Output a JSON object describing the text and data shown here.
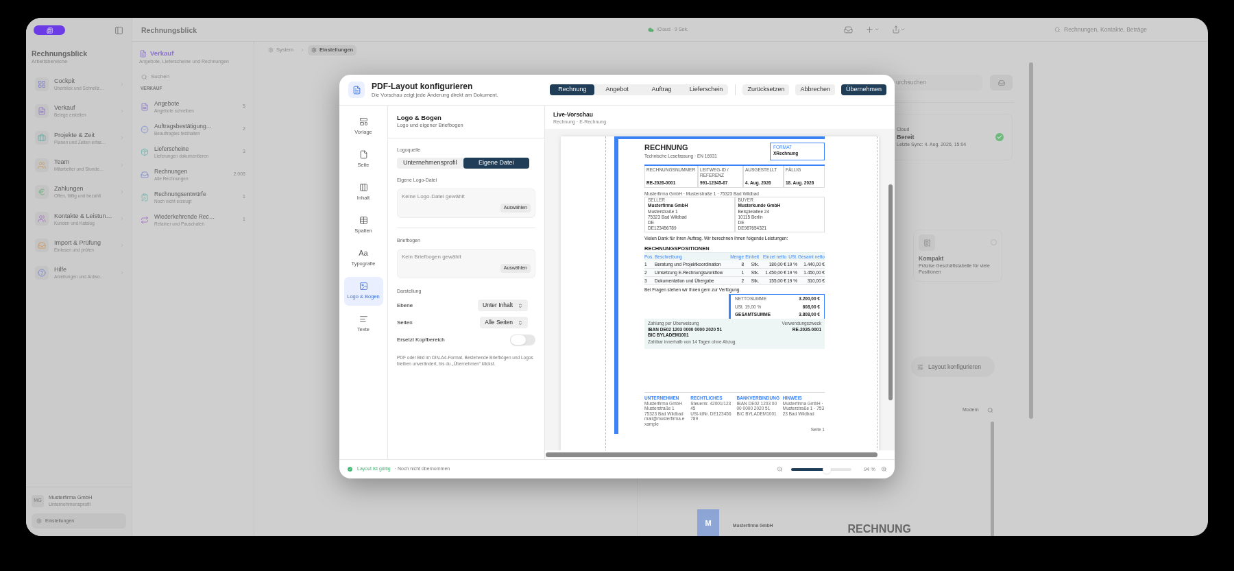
{
  "app": {
    "title": "Rechnungsblick",
    "sync": "iCloud · 9 Sek.",
    "search_placeholder": "Rechnungen, Kontakte, Beträge"
  },
  "breadcrumb": [
    {
      "label": "System",
      "selected": false
    },
    {
      "label": "Einstellungen",
      "selected": true
    }
  ],
  "sidebar": {
    "title": "Rechnungsblick",
    "subtitle": "Arbeitsbereiche",
    "items": [
      {
        "title": "Cockpit",
        "subtitle": "Überblick und Schnellz…"
      },
      {
        "title": "Verkauf",
        "subtitle": "Belege erstellen"
      },
      {
        "title": "Projekte & Zeit",
        "subtitle": "Planen und Zeiten erfas…"
      },
      {
        "title": "Team",
        "subtitle": "Mitarbeiter und Stunde…"
      },
      {
        "title": "Zahlungen",
        "subtitle": "Offen, fällig und bezahlt"
      },
      {
        "title": "Kontakte & Leistun…",
        "subtitle": "Kunden und Katalog"
      },
      {
        "title": "Import & Prüfung",
        "subtitle": "Einlesen und prüfen"
      },
      {
        "title": "Hilfe",
        "subtitle": "Anleitungen und Antwo…"
      }
    ],
    "account": {
      "initials": "MG",
      "name": "Musterfirma GmbH",
      "role": "Unternehmensprofil"
    },
    "settings": "Einstellungen"
  },
  "section_list": {
    "title": "Verkauf",
    "subtitle": "Angebote, Lieferscheine und Rechnungen",
    "search_placeholder": "Suchen",
    "heading": "VERKAUF",
    "items": [
      {
        "title": "Angebote",
        "subtitle": "Angebote schreiben",
        "count": "5"
      },
      {
        "title": "Auftragsbestätigung…",
        "subtitle": "Beauftragtes festhalten",
        "count": "2"
      },
      {
        "title": "Lieferscheine",
        "subtitle": "Lieferungen dokumentieren",
        "count": "3"
      },
      {
        "title": "Rechnungen",
        "subtitle": "Alle Rechnungen",
        "count": "2.005"
      },
      {
        "title": "Rechnungsentwürfe",
        "subtitle": "Noch nicht erzeugt",
        "count": "1"
      },
      {
        "title": "Wiederkehrende Rec…",
        "subtitle": "Retainer und Pauschalen",
        "count": "1"
      }
    ]
  },
  "background": {
    "search_placeholder": "urchsuchen",
    "sync_card": {
      "label": "Cloud",
      "status": "Bereit",
      "detail": "Letzte Sync: 4. Aug. 2026, 15:04"
    },
    "template_card": {
      "title": "Kompakt",
      "description": "Präzise Geschäftstabelle für viele Positionen",
      "selected": false
    },
    "layout_button": "Layout konfigurieren",
    "style_label": "Modern",
    "preview": {
      "logo": "M",
      "company": "Musterfirma GmbH",
      "heading": "RECHNUNG"
    }
  },
  "modal": {
    "title": "PDF-Layout konfigurieren",
    "subtitle": "Die Vorschau zeigt jede Änderung direkt am Dokument.",
    "document_tabs": [
      {
        "label": "Rechnung",
        "selected": true
      },
      {
        "label": "Angebot",
        "selected": false
      },
      {
        "label": "Auftrag",
        "selected": false
      },
      {
        "label": "Lieferschein",
        "selected": false
      }
    ],
    "buttons": [
      {
        "label": "Zurücksetzen",
        "kind": "secondary"
      },
      {
        "label": "Abbrechen",
        "kind": "secondary"
      },
      {
        "label": "Übernehmen",
        "kind": "primary"
      }
    ],
    "nav": [
      {
        "label": "Vorlage",
        "selected": false
      },
      {
        "label": "Seite",
        "selected": false
      },
      {
        "label": "Inhalt",
        "selected": false
      },
      {
        "label": "Spalten",
        "selected": false
      },
      {
        "label": "Typografie",
        "selected": false,
        "icon_text": "Aa"
      },
      {
        "label": "Logo & Bogen",
        "selected": true
      },
      {
        "label": "Texte",
        "selected": false
      }
    ],
    "panel": {
      "title": "Logo & Bogen",
      "subtitle": "Logo und eigener Briefbogen",
      "logo_source": {
        "label": "Logoquelle",
        "options": [
          {
            "label": "Unternehmensprofil",
            "selected": false
          },
          {
            "label": "Eigene Datei",
            "selected": true
          }
        ]
      },
      "logo_file": {
        "label": "Eigene Logo-Datei",
        "empty_text": "Keine Logo-Datei gewählt",
        "button": "Auswählen"
      },
      "letterhead": {
        "label": "Briefbogen",
        "empty_text": "Kein Briefbogen gewählt",
        "button": "Auswählen"
      },
      "display": {
        "label": "Darstellung",
        "rows": [
          {
            "kind": "select",
            "label": "Ebene",
            "value": "Unter Inhalt"
          },
          {
            "kind": "select",
            "label": "Seiten",
            "value": "Alle Seiten"
          },
          {
            "kind": "toggle",
            "label": "Ersetzt Kopfbereich",
            "on": false
          }
        ]
      },
      "note": "PDF oder Bild im DIN-A4-Format. Bestehende Briefbögen und Logos bleiben unverändert, bis du „Übernehmen“ klickst."
    },
    "preview": {
      "title": "Live-Vorschau",
      "subtitle": "Rechnung · E-Rechnung",
      "document": {
        "title": "RECHNUNG",
        "subtitle": "Technische Lesefassung · EN 16931",
        "format": {
          "label": "FORMAT",
          "value": "XRechnung"
        },
        "meta": [
          {
            "label": "RECHNUNGSNUMMER",
            "value": "RE-2026-0001"
          },
          {
            "label": "LEITWEG-ID / REFERENZ",
            "value": "991-12345-67"
          },
          {
            "label": "AUSGESTELLT",
            "value": "4. Aug. 2026"
          },
          {
            "label": "FÄLLIG",
            "value": "18. Aug. 2026"
          }
        ],
        "sender_line": "Musterfirma GmbH · Musterstraße 1 · 75323 Bad Wildbad",
        "parties": [
          {
            "label": "SELLER",
            "name": "Musterfirma GmbH",
            "lines": [
              "Musterstraße 1",
              "75323 Bad Wildbad",
              "DE",
              "DE123456789"
            ]
          },
          {
            "label": "BUYER",
            "name": "Musterkunde GmbH",
            "lines": [
              "Beispielallee 24",
              "10115 Berlin",
              "DE",
              "DE987654321"
            ]
          }
        ],
        "intro": "Vielen Dank für Ihren Auftrag. Wir berechnen Ihnen folgende Leistungen:",
        "section": "RECHNUNGSPOSITIONEN",
        "columns": [
          "Pos.",
          "Beschreibung",
          "Menge",
          "Einheit",
          "Einzel netto",
          "USt.",
          "Gesamt netto"
        ],
        "rows": [
          [
            "1",
            "Beratung und Projektkoordination",
            "8",
            "Stk.",
            "180,00 €",
            "19 %",
            "1.440,00 €"
          ],
          [
            "2",
            "Umsetzung E-Rechnungsworkflow",
            "1",
            "Stk.",
            "1.450,00 €",
            "19 %",
            "1.450,00 €"
          ],
          [
            "3",
            "Dokumentation und Übergabe",
            "2",
            "Stk.",
            "155,00 €",
            "19 %",
            "310,00 €"
          ]
        ],
        "closing": "Bei Fragen stehen wir Ihnen gern zur Verfügung.",
        "totals": [
          {
            "label": "NETTOSUMME",
            "value": "3.200,00 €",
            "strong": false
          },
          {
            "label": "USt. 19,00 %",
            "value": "608,00 €",
            "strong": false
          },
          {
            "label": "GESAMTSUMME",
            "value": "3.808,00 €",
            "strong": true
          }
        ],
        "payment": {
          "label": "Zahlung per Überweisung",
          "reference_label": "Verwendungszweck",
          "iban": "IBAN DE02 1203 0000 0000 2020 51",
          "bic": "BIC BYLADEM1001",
          "reference": "RE-2026-0001",
          "terms": "Zahlbar innerhalb von 14 Tagen ohne Abzug."
        },
        "footer": [
          {
            "label": "UNTERNEHMEN",
            "lines": [
              "Musterfirma GmbH",
              "Musterstraße 1",
              "75323 Bad Wildbad",
              "mail@musterfirma.example"
            ]
          },
          {
            "label": "RECHTLICHES",
            "lines": [
              "Steuernr. 42001/12345",
              "USt-IdNr. DE123456789"
            ]
          },
          {
            "label": "BANKVERBINDUNG",
            "lines": [
              "IBAN DE02 1203 0000 0000 2020 51",
              "BIC BYLADEM1001"
            ]
          },
          {
            "label": "HINWEIS",
            "lines": [
              "Musterfirma GmbH · Musterstraße 1 · 75323 Bad Wildbad"
            ]
          }
        ],
        "page_label": "Seite 1"
      },
      "zoom": {
        "level": 0.59,
        "reading": "94 %"
      }
    },
    "footer": {
      "status": "Layout ist gültig",
      "pending": "· Noch nicht übernommen"
    }
  }
}
